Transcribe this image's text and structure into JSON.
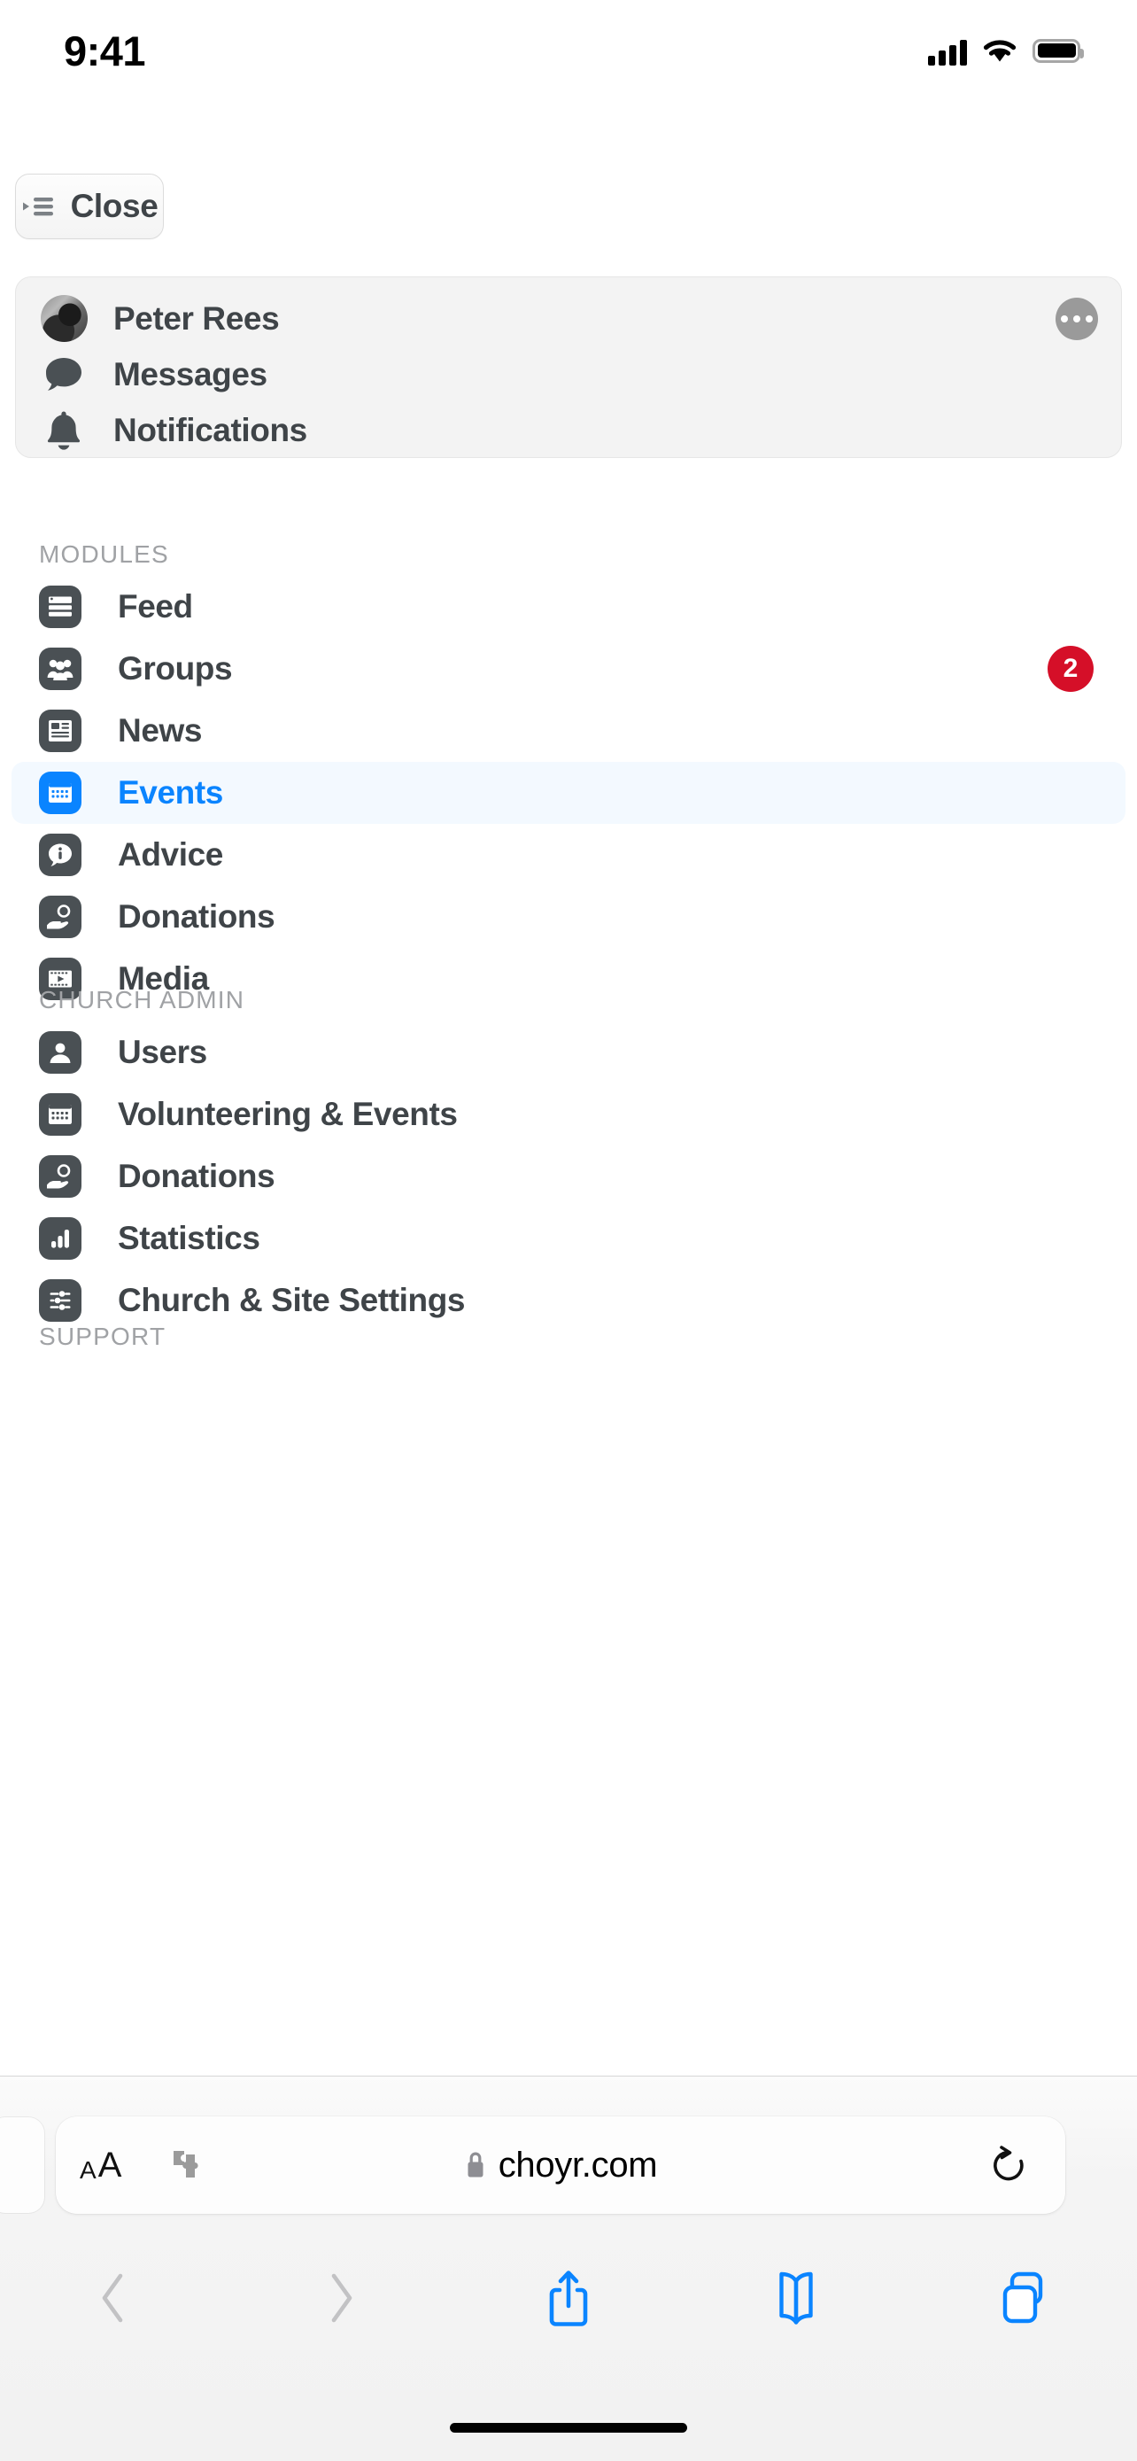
{
  "status_bar": {
    "time": "9:41",
    "cellular_icon": "cellular-signal-icon",
    "wifi_icon": "wifi-icon",
    "battery_icon": "battery-full-icon"
  },
  "page": {
    "close_button": {
      "label": "Close",
      "icon": "sidebar-collapse-icon"
    },
    "profile_card": {
      "user_name": "Peter Rees",
      "avatar_icon": "user-avatar",
      "more_icon": "ellipsis-circle-icon",
      "rows": [
        {
          "label": "Messages",
          "icon": "chat-bubble-icon"
        },
        {
          "label": "Notifications",
          "icon": "bell-icon"
        }
      ]
    },
    "sections": [
      {
        "title": "MODULES",
        "items": [
          {
            "label": "Feed",
            "icon": "feed-icon",
            "badge": "",
            "active": false
          },
          {
            "label": "Groups",
            "icon": "groups-icon",
            "badge": "2",
            "active": false
          },
          {
            "label": "News",
            "icon": "news-icon",
            "badge": "",
            "active": false
          },
          {
            "label": "Events",
            "icon": "calendar-icon",
            "badge": "",
            "active": true
          },
          {
            "label": "Advice",
            "icon": "info-bubble-icon",
            "badge": "",
            "active": false
          },
          {
            "label": "Donations",
            "icon": "hand-coin-icon",
            "badge": "",
            "active": false
          },
          {
            "label": "Media",
            "icon": "media-play-icon",
            "badge": "",
            "active": false
          }
        ]
      },
      {
        "title": "CHURCH ADMIN",
        "items": [
          {
            "label": "Users",
            "icon": "person-icon",
            "badge": "",
            "active": false
          },
          {
            "label": "Volunteering & Events",
            "icon": "calendar-icon",
            "badge": "",
            "active": false
          },
          {
            "label": "Donations",
            "icon": "hand-coin-icon",
            "badge": "",
            "active": false
          },
          {
            "label": "Statistics",
            "icon": "bar-chart-icon",
            "badge": "",
            "active": false
          },
          {
            "label": "Church & Site Settings",
            "icon": "sliders-icon",
            "badge": "",
            "active": false
          }
        ]
      },
      {
        "title": "SUPPORT",
        "items": []
      }
    ]
  },
  "browser": {
    "text_size_small": "A",
    "text_size_large": "A",
    "extensions_icon": "puzzle-piece-icon",
    "lock_icon": "lock-icon",
    "url": "choyr.com",
    "reload_icon": "reload-icon",
    "toolbar": [
      {
        "name": "back",
        "icon": "chevron-left-icon",
        "enabled": false
      },
      {
        "name": "forward",
        "icon": "chevron-right-icon",
        "enabled": false
      },
      {
        "name": "share",
        "icon": "share-icon",
        "enabled": true
      },
      {
        "name": "bookmarks",
        "icon": "book-icon",
        "enabled": true
      },
      {
        "name": "tabs",
        "icon": "tabs-icon",
        "enabled": true
      }
    ]
  },
  "colors": {
    "accent": "#0a84ff",
    "badge_red": "#d50f28",
    "icon_dark": "#4a5054",
    "text_dark": "#3f4448",
    "section_label": "#a0a2a5",
    "active_row_bg": "#f3f9ff"
  }
}
